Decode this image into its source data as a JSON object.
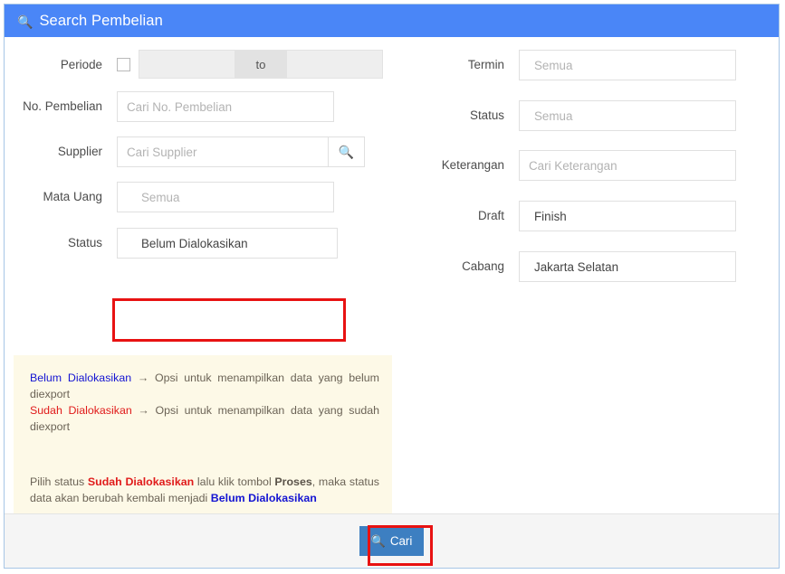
{
  "header": {
    "icon": "search-icon",
    "title": "Search Pembelian"
  },
  "left_fields": {
    "periode": {
      "label": "Periode",
      "checkbox_checked": false,
      "start_value": "",
      "end_value": "",
      "separator": "to",
      "disabled": true
    },
    "no_pembelian": {
      "label": "No. Pembelian",
      "placeholder": "Cari No. Pembelian",
      "value": ""
    },
    "supplier": {
      "label": "Supplier",
      "placeholder": "Cari Supplier",
      "value": "",
      "search_button_icon": "search-icon"
    },
    "mata_uang": {
      "label": "Mata Uang",
      "value": "Semua",
      "is_placeholder": true
    },
    "status": {
      "label": "Status",
      "value": "Belum Dialokasikan",
      "is_placeholder": false,
      "highlighted": true
    }
  },
  "right_fields": {
    "termin": {
      "label": "Termin",
      "value": "Semua",
      "is_placeholder": true
    },
    "status": {
      "label": "Status",
      "value": "Semua",
      "is_placeholder": true
    },
    "keterangan": {
      "label": "Keterangan",
      "placeholder": "Cari Keterangan",
      "value": ""
    },
    "draft": {
      "label": "Draft",
      "value": "Finish",
      "clear_icon": "close-icon"
    },
    "cabang": {
      "label": "Cabang",
      "value": "Jakarta Selatan"
    }
  },
  "note": {
    "line1_term": "Belum Dialokasikan",
    "line1_arrow": "→",
    "line1_text": "Opsi untuk menampilkan data yang belum diexport",
    "line2_term": "Sudah Dialokasikan",
    "line2_arrow": "→",
    "line2_text": "Opsi untuk menampilkan data yang sudah diexport",
    "p2_a": "Pilih status",
    "p2_term1": "Sudah Dialokasikan",
    "p2_b": "lalu klik tombol",
    "p2_term2": "Proses",
    "p2_c": ", maka status data akan berubah kembali menjadi",
    "p2_term3": "Belum Dialokasikan"
  },
  "footer": {
    "search_button_label": "Cari",
    "search_button_icon": "search-icon"
  },
  "colors": {
    "header_blue": "#4a86f7",
    "primary_button": "#3d7fc1",
    "highlight_red": "#e81212",
    "note_bg": "#fdf9e7",
    "term_blue": "#1414d2",
    "term_red": "#e01b1b"
  }
}
